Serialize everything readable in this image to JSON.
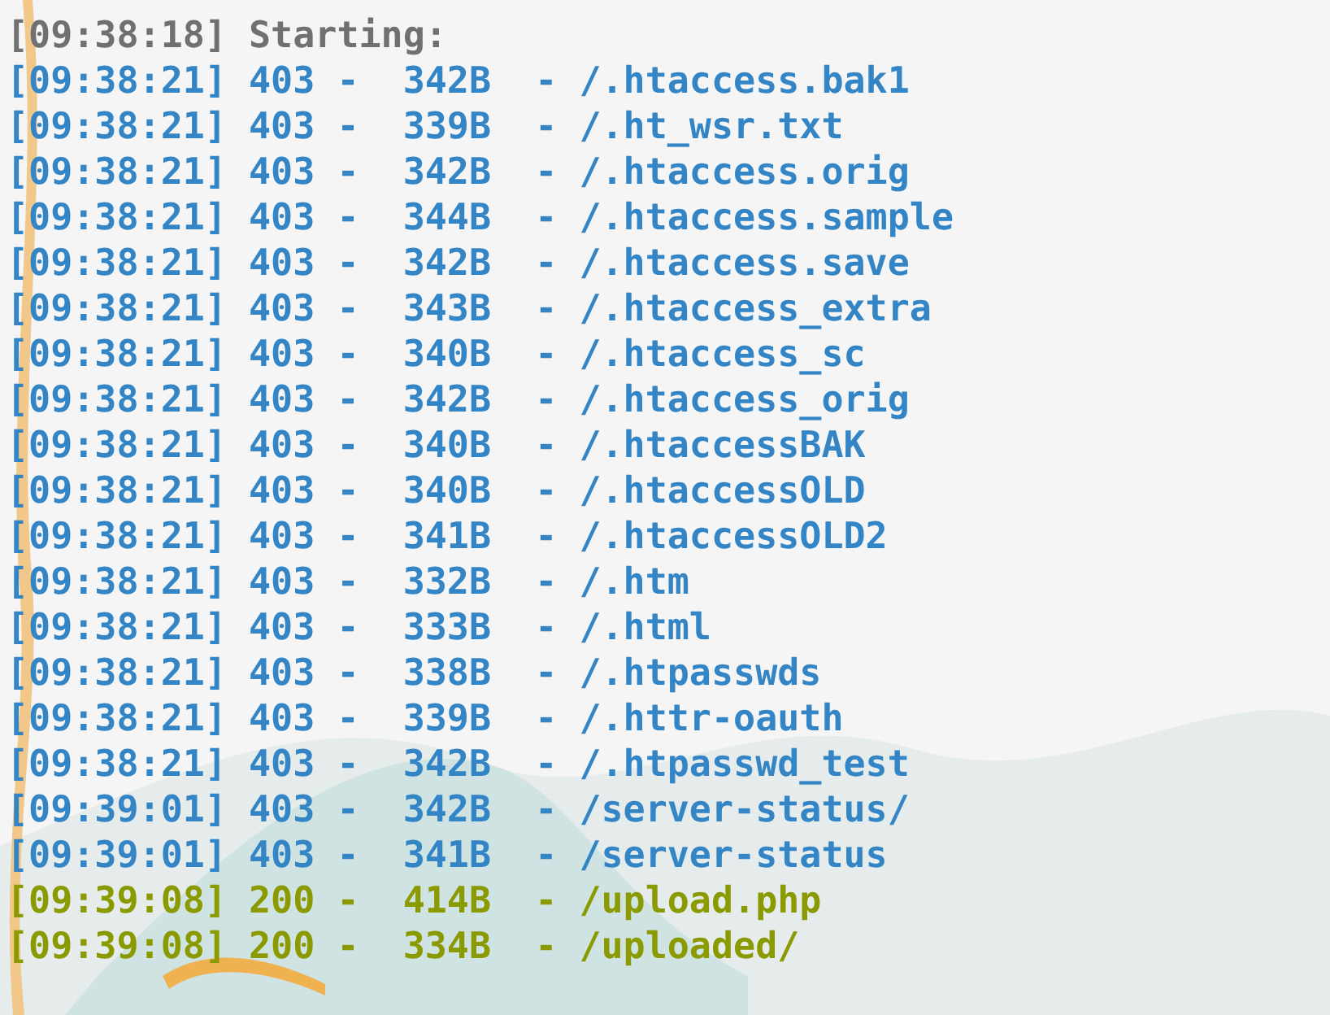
{
  "lines": [
    {
      "kind": "info",
      "text": "[09:38:18] Starting:"
    },
    {
      "kind": "forbidden",
      "text": "[09:38:21] 403 -  342B  - /.htaccess.bak1"
    },
    {
      "kind": "forbidden",
      "text": "[09:38:21] 403 -  339B  - /.ht_wsr.txt"
    },
    {
      "kind": "forbidden",
      "text": "[09:38:21] 403 -  342B  - /.htaccess.orig"
    },
    {
      "kind": "forbidden",
      "text": "[09:38:21] 403 -  344B  - /.htaccess.sample"
    },
    {
      "kind": "forbidden",
      "text": "[09:38:21] 403 -  342B  - /.htaccess.save"
    },
    {
      "kind": "forbidden",
      "text": "[09:38:21] 403 -  343B  - /.htaccess_extra"
    },
    {
      "kind": "forbidden",
      "text": "[09:38:21] 403 -  340B  - /.htaccess_sc"
    },
    {
      "kind": "forbidden",
      "text": "[09:38:21] 403 -  342B  - /.htaccess_orig"
    },
    {
      "kind": "forbidden",
      "text": "[09:38:21] 403 -  340B  - /.htaccessBAK"
    },
    {
      "kind": "forbidden",
      "text": "[09:38:21] 403 -  340B  - /.htaccessOLD"
    },
    {
      "kind": "forbidden",
      "text": "[09:38:21] 403 -  341B  - /.htaccessOLD2"
    },
    {
      "kind": "forbidden",
      "text": "[09:38:21] 403 -  332B  - /.htm"
    },
    {
      "kind": "forbidden",
      "text": "[09:38:21] 403 -  333B  - /.html"
    },
    {
      "kind": "forbidden",
      "text": "[09:38:21] 403 -  338B  - /.htpasswds"
    },
    {
      "kind": "forbidden",
      "text": "[09:38:21] 403 -  339B  - /.httr-oauth"
    },
    {
      "kind": "forbidden",
      "text": "[09:38:21] 403 -  342B  - /.htpasswd_test"
    },
    {
      "kind": "forbidden",
      "text": "[09:39:01] 403 -  342B  - /server-status/"
    },
    {
      "kind": "forbidden",
      "text": "[09:39:01] 403 -  341B  - /server-status"
    },
    {
      "kind": "ok",
      "text": "[09:39:08] 200 -  414B  - /upload.php"
    },
    {
      "kind": "ok",
      "text": "[09:39:08] 200 -  334B  - /uploaded/"
    }
  ]
}
